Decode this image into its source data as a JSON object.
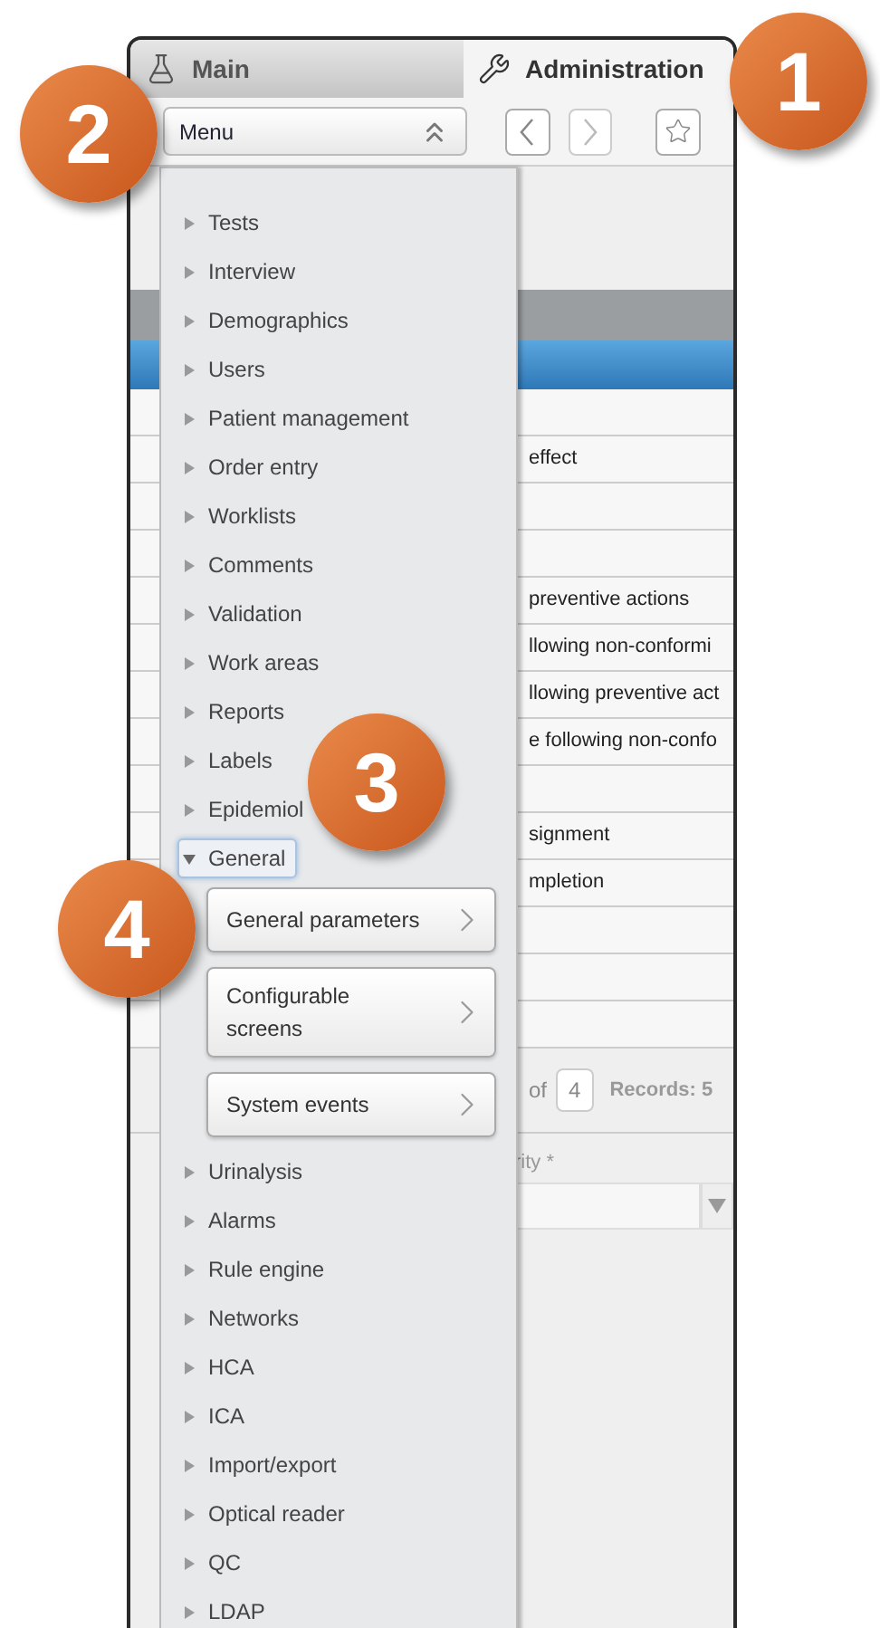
{
  "tabs": [
    {
      "label": "Main",
      "selected": false
    },
    {
      "label": "Administration",
      "selected": true
    }
  ],
  "menu_button": {
    "label": "Menu",
    "expanded": true
  },
  "background_rows": [
    {
      "text": "",
      "selected": true
    },
    {
      "text": "",
      "selected": false
    },
    {
      "text": "effect",
      "selected": false
    },
    {
      "text": "",
      "selected": false
    },
    {
      "text": "",
      "selected": false
    },
    {
      "text": "preventive actions",
      "selected": false
    },
    {
      "text": "llowing non-conformi",
      "selected": false
    },
    {
      "text": "llowing preventive act",
      "selected": false
    },
    {
      "text": "e following non-confo",
      "selected": false
    },
    {
      "text": "",
      "selected": false
    },
    {
      "text": "signment",
      "selected": false
    },
    {
      "text": "mpletion",
      "selected": false
    },
    {
      "text": "",
      "selected": false
    },
    {
      "text": "",
      "selected": false
    },
    {
      "text": "",
      "selected": false
    }
  ],
  "pagination": {
    "of_label": "of",
    "pages": "4",
    "records": "Records: 5"
  },
  "filter": {
    "label": "rity *"
  },
  "menu_items": [
    {
      "label": "Tests",
      "expanded": false,
      "selected": false
    },
    {
      "label": "Interview",
      "expanded": false,
      "selected": false
    },
    {
      "label": "Demographics",
      "expanded": false,
      "selected": false
    },
    {
      "label": "Users",
      "expanded": false,
      "selected": false
    },
    {
      "label": "Patient management",
      "expanded": false,
      "selected": false
    },
    {
      "label": "Order entry",
      "expanded": false,
      "selected": false
    },
    {
      "label": "Worklists",
      "expanded": false,
      "selected": false
    },
    {
      "label": "Comments",
      "expanded": false,
      "selected": false
    },
    {
      "label": "Validation",
      "expanded": false,
      "selected": false
    },
    {
      "label": "Work areas",
      "expanded": false,
      "selected": false
    },
    {
      "label": "Reports",
      "expanded": false,
      "selected": false
    },
    {
      "label": "Labels",
      "expanded": false,
      "selected": false
    },
    {
      "label": "Epidemiol",
      "expanded": false,
      "selected": false
    },
    {
      "label": "General",
      "expanded": true,
      "selected": true,
      "children": [
        {
          "label": "General parameters"
        },
        {
          "label": "Configurable screens"
        },
        {
          "label": "System events"
        }
      ]
    },
    {
      "label": "Urinalysis",
      "expanded": false,
      "selected": false
    },
    {
      "label": "Alarms",
      "expanded": false,
      "selected": false
    },
    {
      "label": "Rule engine",
      "expanded": false,
      "selected": false
    },
    {
      "label": "Networks",
      "expanded": false,
      "selected": false
    },
    {
      "label": "HCA",
      "expanded": false,
      "selected": false
    },
    {
      "label": "ICA",
      "expanded": false,
      "selected": false
    },
    {
      "label": "Import/export",
      "expanded": false,
      "selected": false
    },
    {
      "label": "Optical reader",
      "expanded": false,
      "selected": false
    },
    {
      "label": "QC",
      "expanded": false,
      "selected": false
    },
    {
      "label": "LDAP",
      "expanded": false,
      "selected": false
    }
  ],
  "callouts": [
    {
      "number": "1",
      "kind": "tabs"
    },
    {
      "number": "2",
      "kind": "menu"
    },
    {
      "number": "3",
      "kind": "item"
    },
    {
      "number": "4",
      "kind": "submenu"
    }
  ]
}
